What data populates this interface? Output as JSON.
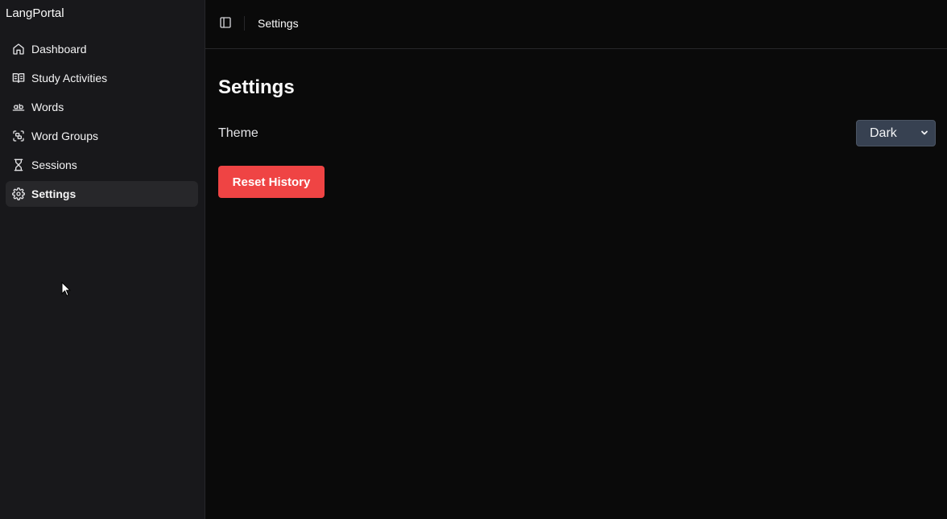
{
  "app": {
    "title": "LangPortal"
  },
  "sidebar": {
    "items": [
      {
        "label": "Dashboard",
        "icon": "house-icon"
      },
      {
        "label": "Study Activities",
        "icon": "book-open-icon"
      },
      {
        "label": "Words",
        "icon": "whole-word-icon"
      },
      {
        "label": "Word Groups",
        "icon": "group-icon"
      },
      {
        "label": "Sessions",
        "icon": "hourglass-icon"
      },
      {
        "label": "Settings",
        "icon": "gear-icon",
        "active": true
      }
    ]
  },
  "header": {
    "breadcrumb": "Settings"
  },
  "main": {
    "title": "Settings",
    "theme": {
      "label": "Theme",
      "selected": "Dark"
    },
    "reset_label": "Reset History"
  },
  "colors": {
    "danger": "#ef4444",
    "sidebar_bg": "#18181b",
    "main_bg": "#0a0a0a"
  }
}
